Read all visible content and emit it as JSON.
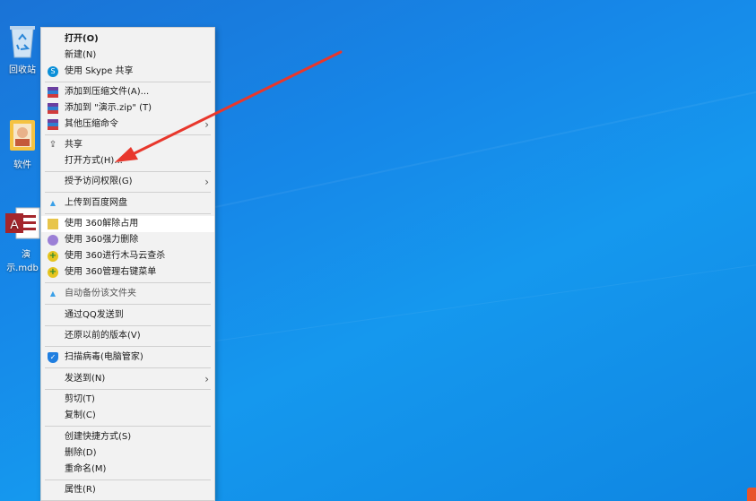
{
  "desktop": {
    "icons": [
      {
        "name": "recycle-bin",
        "label": "回收站"
      },
      {
        "name": "software-folder",
        "label": "软件"
      },
      {
        "name": "mdb-file",
        "label": "演示.mdb"
      }
    ]
  },
  "context_menu": {
    "items": {
      "open": "打开(O)",
      "new": "新建(N)",
      "skype_share": "使用 Skype 共享",
      "add_to_archive": "添加到压缩文件(A)...",
      "add_to_zip": "添加到 \"演示.zip\" (T)",
      "other_compress": "其他压缩命令",
      "share": "共享",
      "open_with": "打开方式(H)...",
      "grant_access": "授予访问权限(G)",
      "upload_baidu": "上传到百度网盘",
      "unlock_360": "使用 360解除占用",
      "force_delete_360": "使用 360强力删除",
      "trojan_scan_360": "使用 360进行木马云查杀",
      "manage_menu_360": "使用 360管理右键菜单",
      "auto_backup": "自动备份该文件夹",
      "send_qq": "通过QQ发送到",
      "restore_versions": "还原以前的版本(V)",
      "virus_scan": "扫描病毒(电脑管家)",
      "send_to": "发送到(N)",
      "cut": "剪切(T)",
      "copy": "复制(C)",
      "create_shortcut": "创建快捷方式(S)",
      "delete": "删除(D)",
      "rename": "重命名(M)",
      "properties": "属性(R)"
    },
    "submenu_arrow": "›"
  },
  "colors": {
    "desktop_blue": "#1687e8",
    "menu_bg": "#f2f2f2",
    "arrow_red": "#e8372c"
  }
}
